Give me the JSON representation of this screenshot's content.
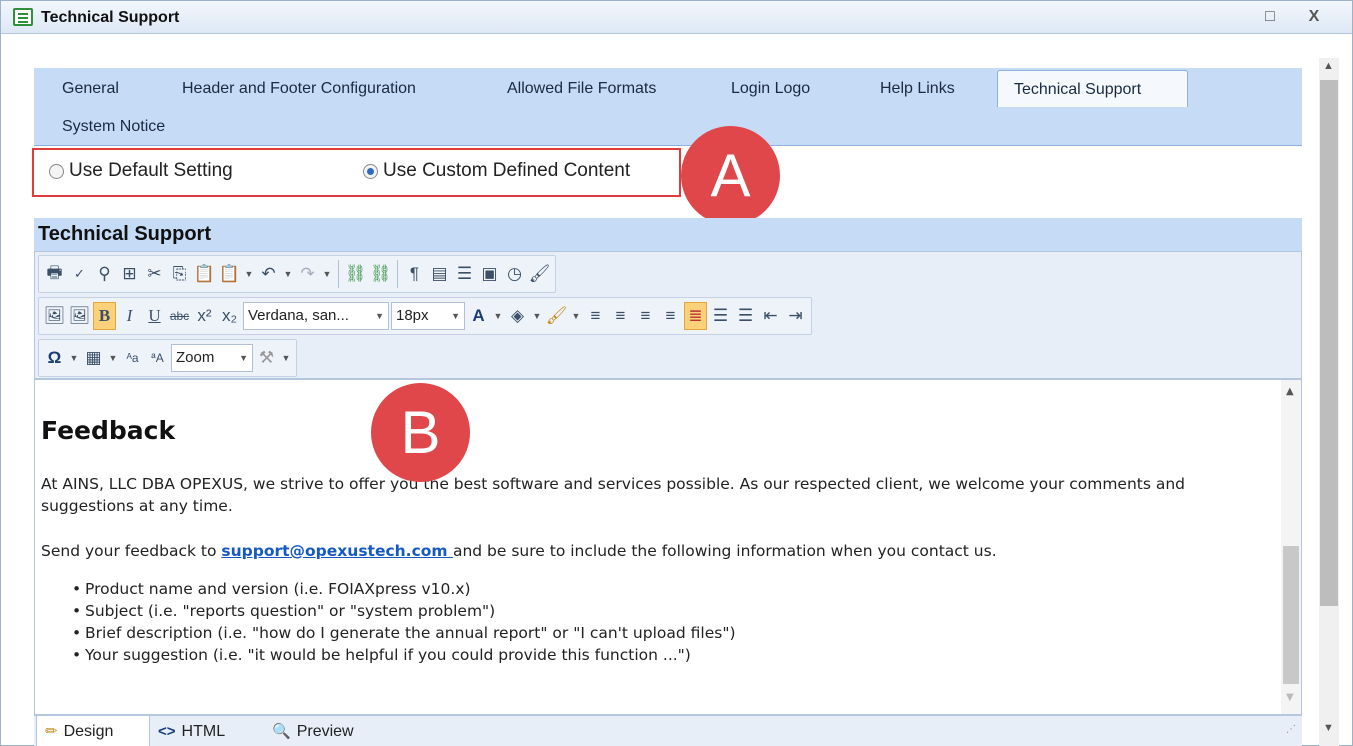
{
  "window": {
    "title": "Technical Support",
    "icon": "document-list-icon",
    "maximize_glyph": "□",
    "close_glyph": "X"
  },
  "tabs": [
    {
      "label": "General"
    },
    {
      "label": "Header and Footer Configuration"
    },
    {
      "label": "Allowed File Formats"
    },
    {
      "label": "Login Logo"
    },
    {
      "label": "Help Links"
    },
    {
      "label": "Technical Support",
      "active": true
    },
    {
      "label": "System Notice"
    }
  ],
  "content_source": {
    "options": [
      {
        "label": "Use Default Setting",
        "selected": false
      },
      {
        "label": "Use Custom Defined Content",
        "selected": true
      }
    ]
  },
  "callouts": {
    "a": "A",
    "b": "B"
  },
  "editor": {
    "section_title": "Technical Support",
    "font_family": "Verdana, san...",
    "font_size": "18px",
    "zoom": "Zoom",
    "content": {
      "heading": "Feedback",
      "paragraph1": "At AINS, LLC DBA OPEXUS, we strive to offer you the best software and services possible. As our respected client, we welcome your comments and suggestions at any time.",
      "p2_before": "Send your feedback to ",
      "email": "support@opexustech.com ",
      "p2_after": "and be sure to include the following information when you contact us.",
      "bullets": [
        "Product name and version (i.e. FOIAXpress v10.x)",
        "Subject (i.e. \"reports question\" or \"system problem\")",
        "Brief description (i.e. \"how do I generate the annual report\" or \"I can't upload files\")",
        "Your suggestion (i.e. \"it would be helpful if you could provide this function ...\")"
      ]
    },
    "modes": [
      {
        "label": "Design",
        "icon": "pencil-icon",
        "active": true
      },
      {
        "label": "HTML",
        "icon": "code-icon",
        "active": false
      },
      {
        "label": "Preview",
        "icon": "magnifier-icon",
        "active": false
      }
    ]
  },
  "colors": {
    "accent_blue": "#c5dbf6",
    "callout_red": "#e0474a",
    "link_blue": "#1559c2"
  }
}
